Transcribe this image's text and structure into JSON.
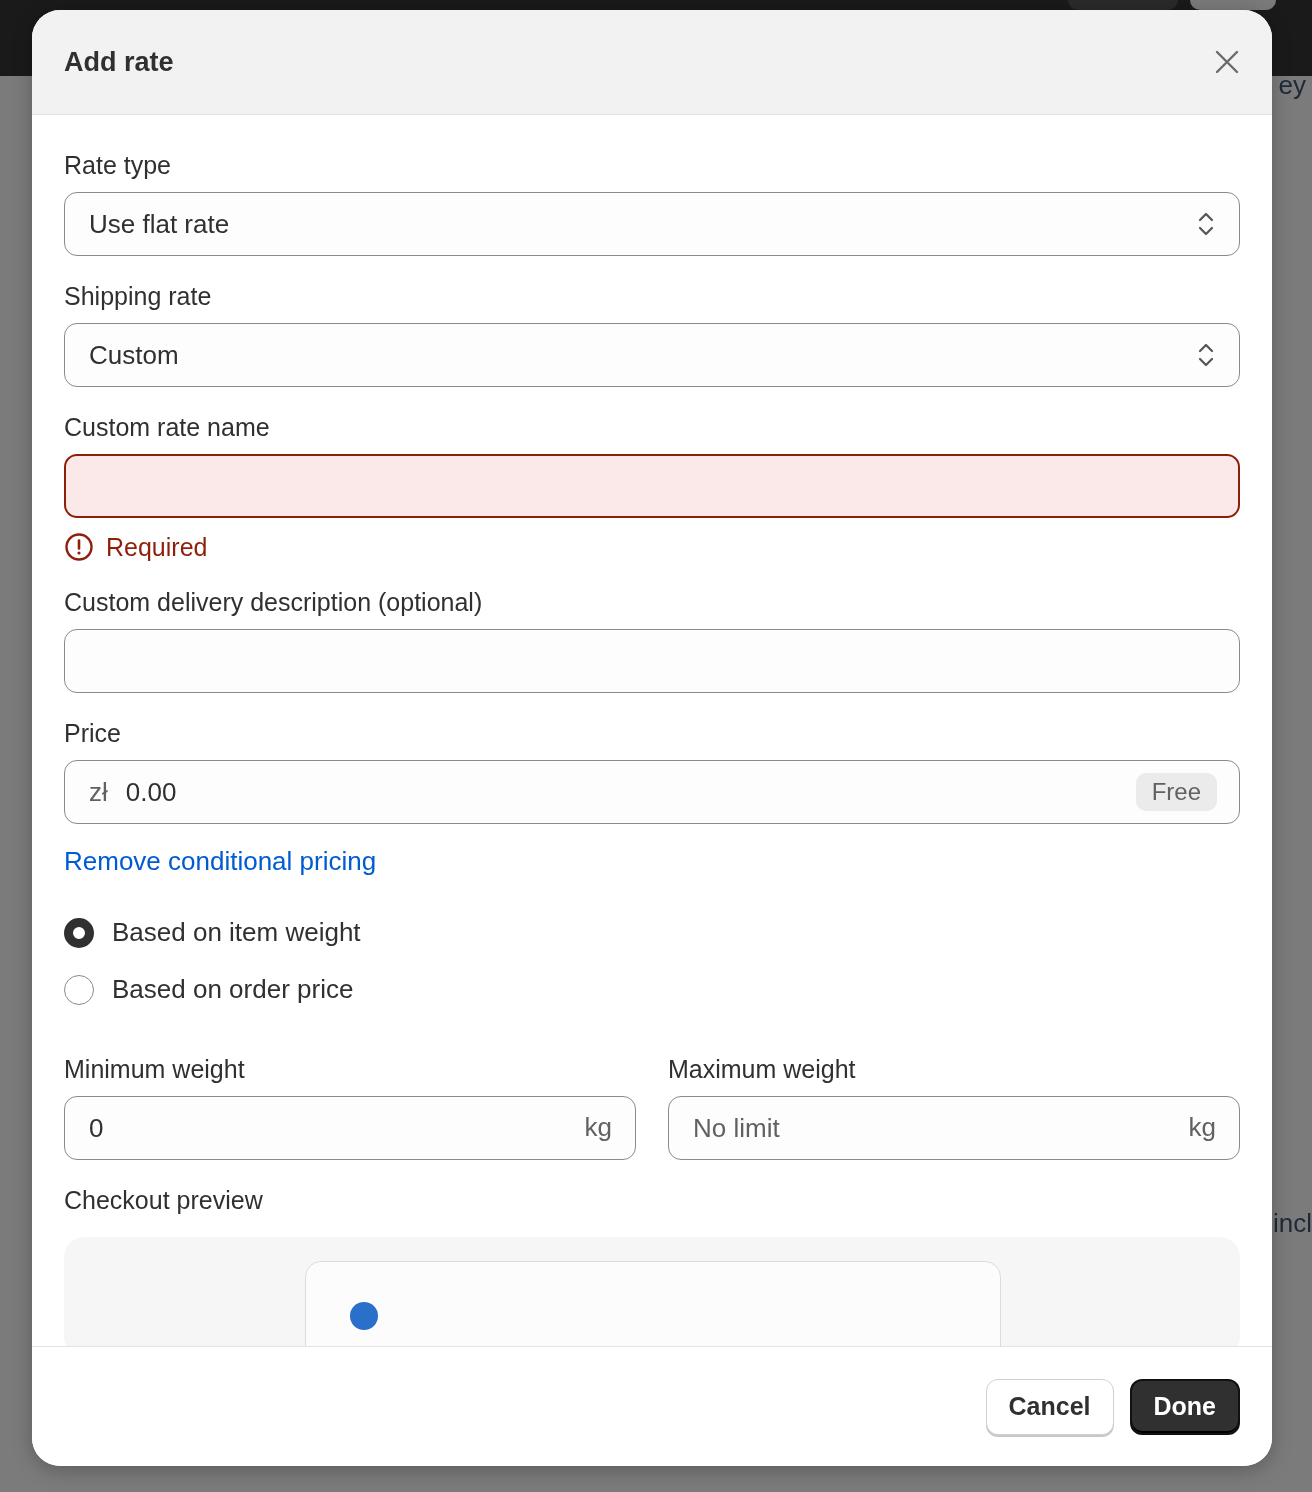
{
  "background": {
    "side_texts": [
      "ey",
      "incl"
    ]
  },
  "modal": {
    "title": "Add rate",
    "fields": [
      {
        "kind": "select",
        "label": "Rate type",
        "value": "Use flat rate"
      },
      {
        "kind": "select",
        "label": "Shipping rate",
        "value": "Custom"
      },
      {
        "kind": "text",
        "label": "Custom rate name",
        "invalid": true,
        "error": "Required"
      },
      {
        "kind": "text",
        "label": "Custom delivery description (optional)",
        "invalid": false
      },
      {
        "kind": "price",
        "label": "Price",
        "prefix": "zł",
        "value": "0.00",
        "badge": "Free"
      }
    ],
    "link": "Remove conditional pricing",
    "radios": [
      {
        "label": "Based on item weight",
        "selected": true
      },
      {
        "label": "Based on order price",
        "selected": false
      }
    ],
    "range": [
      {
        "label": "Minimum weight",
        "value": "0",
        "suffix": "kg"
      },
      {
        "label": "Maximum weight",
        "placeholder": "No limit",
        "suffix": "kg"
      }
    ],
    "preview_label": "Checkout preview",
    "buttons": [
      {
        "label": "Cancel",
        "primary": false
      },
      {
        "label": "Done",
        "primary": true
      }
    ]
  }
}
